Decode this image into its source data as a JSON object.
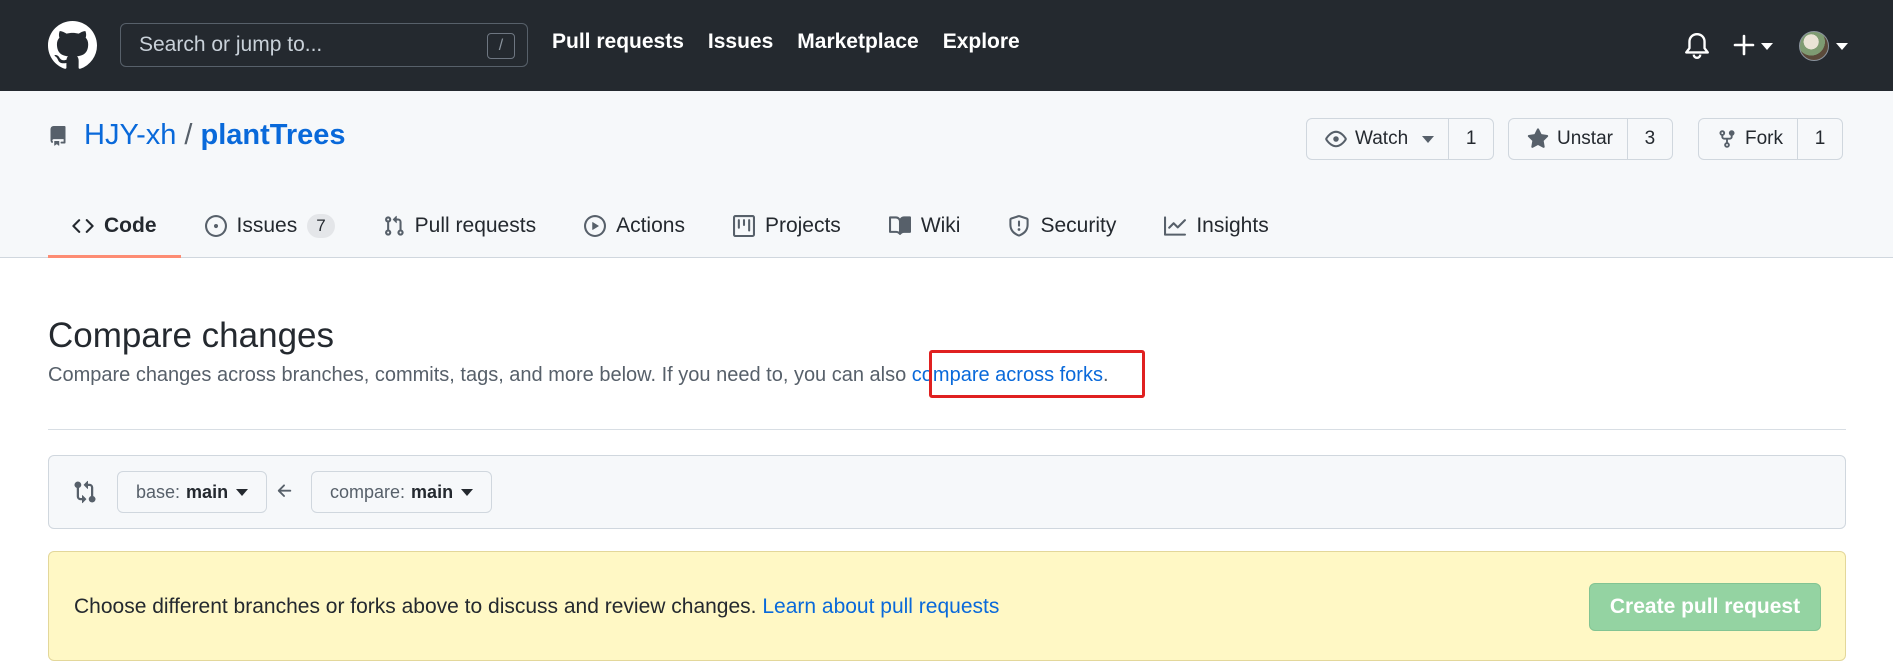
{
  "header": {
    "search_placeholder": "Search or jump to...",
    "search_key": "/",
    "nav": [
      "Pull requests",
      "Issues",
      "Marketplace",
      "Explore"
    ]
  },
  "repo": {
    "owner": "HJY-xh",
    "separator": "/",
    "name": "plantTrees",
    "watch": {
      "label": "Watch",
      "count": "1"
    },
    "star": {
      "label": "Unstar",
      "count": "3"
    },
    "fork": {
      "label": "Fork",
      "count": "1"
    }
  },
  "tabs": [
    {
      "label": "Code",
      "icon": "code-icon",
      "active": true
    },
    {
      "label": "Issues",
      "icon": "issue-opened-icon",
      "badge": "7"
    },
    {
      "label": "Pull requests",
      "icon": "git-pull-request-icon"
    },
    {
      "label": "Actions",
      "icon": "play-icon"
    },
    {
      "label": "Projects",
      "icon": "project-icon"
    },
    {
      "label": "Wiki",
      "icon": "book-icon"
    },
    {
      "label": "Security",
      "icon": "shield-icon"
    },
    {
      "label": "Insights",
      "icon": "graph-icon"
    }
  ],
  "compare": {
    "title": "Compare changes",
    "description": "Compare changes across branches, commits, tags, and more below. If you need to, you can also ",
    "forks_link": "compare across forks",
    "period": ".",
    "base_prefix": "base:",
    "base_branch": "main",
    "compare_prefix": "compare:",
    "compare_branch": "main"
  },
  "flash": {
    "text": "Choose different branches or forks above to discuss and review changes. ",
    "link": "Learn about pull requests",
    "button": "Create pull request"
  },
  "colors": {
    "header_bg": "#24292f",
    "link": "#0969da",
    "active_tab": "#fd8c73",
    "flash_bg": "#fff8c5",
    "create_pr_disabled": "#94d3a2",
    "highlight": "#e02020"
  }
}
